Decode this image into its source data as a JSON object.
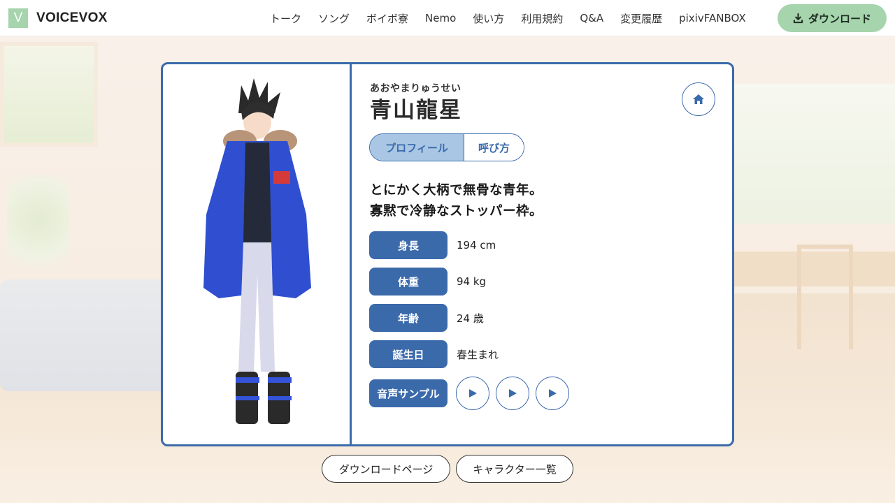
{
  "header": {
    "logo_letter": "V",
    "logo_text": "VOICEVOX",
    "nav": [
      "トーク",
      "ソング",
      "ボイボ寮",
      "Nemo",
      "使い方",
      "利用規約",
      "Q&A",
      "変更履歴",
      "pixivFANBOX"
    ],
    "download_label": "ダウンロード"
  },
  "character": {
    "ruby": "あおやまりゅうせい",
    "name": "青山龍星",
    "tabs": [
      {
        "label": "プロフィール",
        "active": true
      },
      {
        "label": "呼び方",
        "active": false
      }
    ],
    "catchphrase": [
      "とにかく大柄で無骨な青年。",
      "寡黙で冷静なストッパー枠。"
    ],
    "profile": [
      {
        "label": "身長",
        "value": "194 cm"
      },
      {
        "label": "体重",
        "value": "94 kg"
      },
      {
        "label": "年齢",
        "value": "24 歳"
      },
      {
        "label": "誕生日",
        "value": "春生まれ"
      }
    ],
    "samples_label": "音声サンプル",
    "sample_count": 3
  },
  "footer_buttons": {
    "download_page": "ダウンロードページ",
    "character_list": "キャラクター一覧"
  },
  "colors": {
    "accent": "#3b6aab",
    "brand_green": "#a5d4ad",
    "tab_active": "#a9c7e4"
  },
  "icons": [
    "download-icon",
    "home-icon",
    "play-icon"
  ]
}
